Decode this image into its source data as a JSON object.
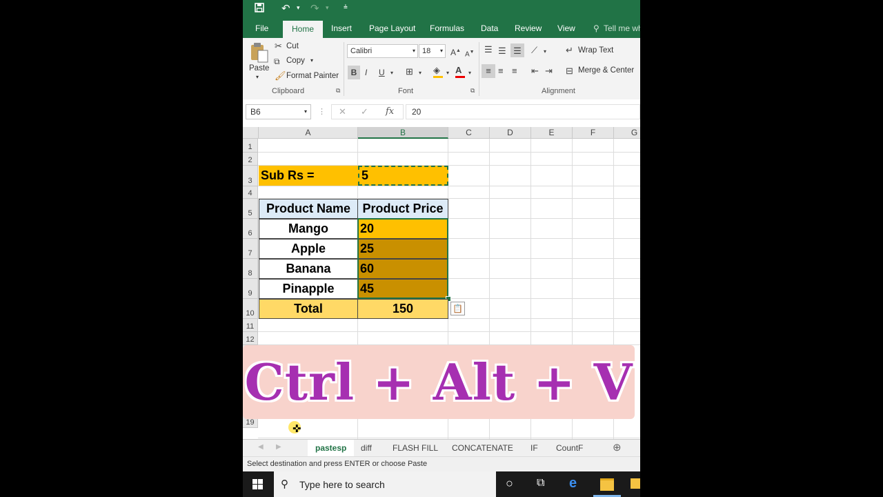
{
  "qat": {
    "save_icon": "save-icon",
    "undo_icon": "undo-icon",
    "redo_icon": "redo-icon",
    "customize_icon": "customize-icon"
  },
  "tabs": [
    "File",
    "Home",
    "Insert",
    "Page Layout",
    "Formulas",
    "Data",
    "Review",
    "View"
  ],
  "active_tab": "Home",
  "tell_me": "Tell me wh",
  "clipboard": {
    "paste": "Paste",
    "cut": "Cut",
    "copy": "Copy",
    "format_painter": "Format Painter",
    "group": "Clipboard"
  },
  "font": {
    "name": "Calibri",
    "size": "18",
    "bold": "B",
    "italic": "I",
    "underline": "U",
    "group": "Font"
  },
  "alignment": {
    "wrap_text": "Wrap Text",
    "merge_center": "Merge & Center",
    "group": "Alignment"
  },
  "formula_bar": {
    "name_box": "B6",
    "cancel": "✕",
    "enter": "✓",
    "fx": "fx",
    "value": "20"
  },
  "columns": [
    "A",
    "B",
    "C",
    "D",
    "E",
    "F",
    "G"
  ],
  "rows": [
    "1",
    "2",
    "3",
    "4",
    "5",
    "6",
    "7",
    "8",
    "9",
    "10",
    "11",
    "12",
    "19"
  ],
  "sheet": {
    "sub_label": "Sub Rs =",
    "sub_value": "5",
    "header_name": "Product Name",
    "header_price": "Product Price",
    "items": [
      {
        "name": "Mango",
        "price": "20"
      },
      {
        "name": "Apple",
        "price": "25"
      },
      {
        "name": "Banana",
        "price": "60"
      },
      {
        "name": "Pinapple",
        "price": "45"
      }
    ],
    "total_label": "Total",
    "total_value": "150"
  },
  "sheet_tabs": [
    "pastesp",
    "diff",
    "FLASH FILL",
    "CONCATENATE",
    "IF",
    "CountF"
  ],
  "active_sheet": "pastesp",
  "status": "Select destination and press ENTER or choose Paste",
  "taskbar": {
    "search_placeholder": "Type here to search"
  },
  "overlay": {
    "text": "Ctrl + Alt + V"
  },
  "colors": {
    "excel_green": "#217346",
    "orange": "#ffc000",
    "dark_orange": "#c99000",
    "light_blue": "#ddebf7",
    "total_fill": "#ffd966",
    "overlay_bg": "#f8d3cc",
    "overlay_text": "#a62fb1"
  }
}
